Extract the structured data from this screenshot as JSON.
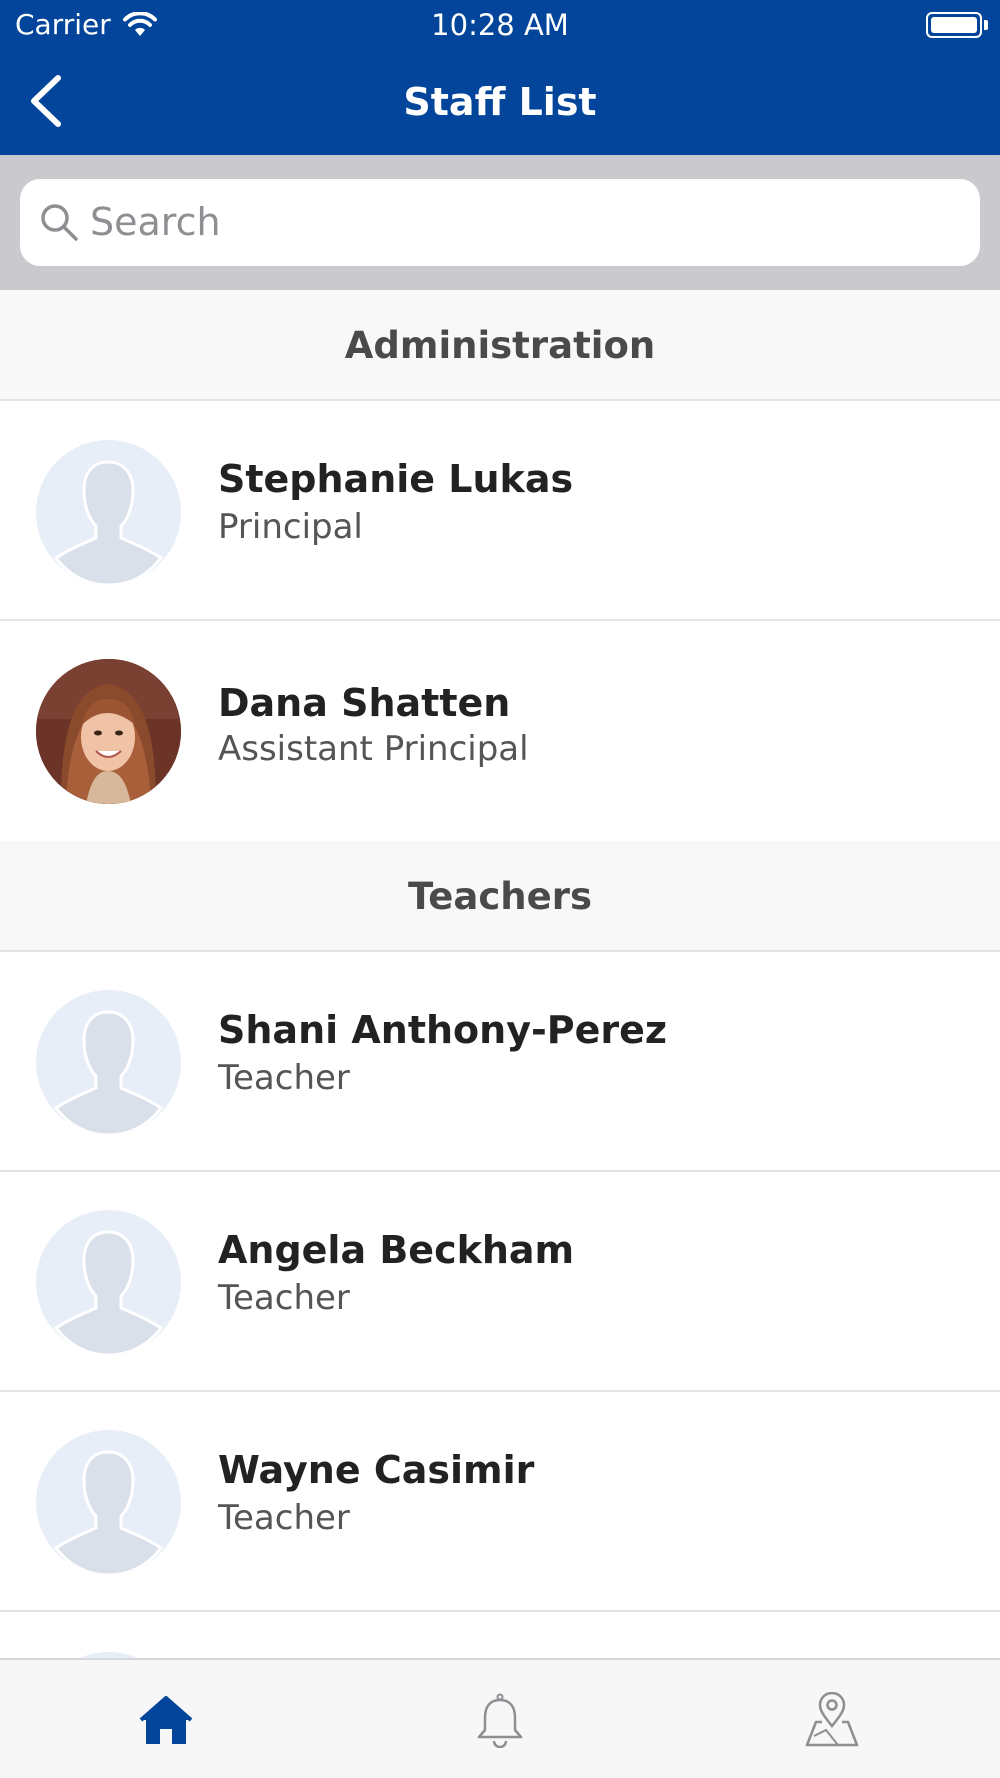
{
  "status_bar": {
    "carrier": "Carrier",
    "time": "10:28 AM"
  },
  "nav": {
    "title": "Staff List",
    "back_icon": "chevron-left-icon"
  },
  "search": {
    "placeholder": "Search",
    "value": "",
    "icon": "search-icon"
  },
  "sections": [
    {
      "title": "Administration",
      "items": [
        {
          "name": "Stephanie Lukas",
          "role": "Principal",
          "avatar": "placeholder-silhouette"
        },
        {
          "name": "Dana Shatten",
          "role": "Assistant Principal",
          "avatar": "photo"
        }
      ]
    },
    {
      "title": "Teachers",
      "items": [
        {
          "name": "Shani Anthony-Perez",
          "role": "Teacher",
          "avatar": "placeholder-silhouette"
        },
        {
          "name": "Angela Beckham",
          "role": "Teacher",
          "avatar": "placeholder-silhouette"
        },
        {
          "name": "Wayne Casimir",
          "role": "Teacher",
          "avatar": "placeholder-silhouette"
        }
      ]
    }
  ],
  "tab_bar": {
    "tabs": [
      {
        "icon": "home-icon",
        "active": true
      },
      {
        "icon": "bell-icon",
        "active": false
      },
      {
        "icon": "map-pin-icon",
        "active": false
      }
    ]
  },
  "colors": {
    "brand": "#02459a",
    "search_background": "#c9c9ce",
    "section_header_background": "#f8f8f8",
    "active_tab": "#02459a",
    "inactive_tab": "#8e8e93"
  }
}
